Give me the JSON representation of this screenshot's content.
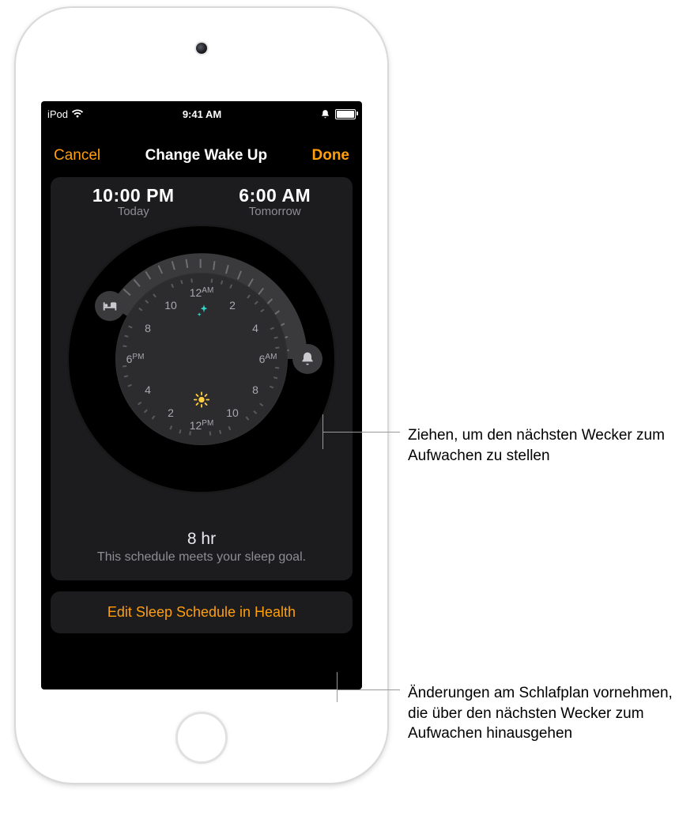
{
  "status": {
    "carrier": "iPod",
    "time": "9:41 AM"
  },
  "nav": {
    "cancel": "Cancel",
    "title": "Change Wake Up",
    "done": "Done"
  },
  "bedtime": {
    "time": "10:00 PM",
    "label": "Today"
  },
  "wakeup": {
    "time": "6:00 AM",
    "label": "Tomorrow"
  },
  "dial": {
    "labels": {
      "top": "12",
      "top_ampm": "AM",
      "right": "6",
      "right_ampm": "AM",
      "bottom": "12",
      "bottom_ampm": "PM",
      "left": "6",
      "left_ampm": "PM",
      "h2a": "2",
      "h4a": "4",
      "h8a": "8",
      "h10a": "10",
      "h2b": "2",
      "h4b": "4",
      "h8b": "8",
      "h10b": "10"
    }
  },
  "summary": {
    "duration": "8 hr",
    "note": "This schedule meets your sleep goal."
  },
  "edit_button": "Edit Sleep Schedule in Health",
  "callouts": {
    "wake_drag": "Ziehen, um den nächsten Wecker zum Aufwachen zu stellen",
    "edit_schedule": "Änderungen am Schlafplan vornehmen, die über den nächsten Wecker zum Aufwachen hinausgehen"
  },
  "icons": {
    "bed": "bed-icon",
    "bell": "bell-icon",
    "sparkle": "sparkle-icon",
    "sun": "sun-icon"
  }
}
